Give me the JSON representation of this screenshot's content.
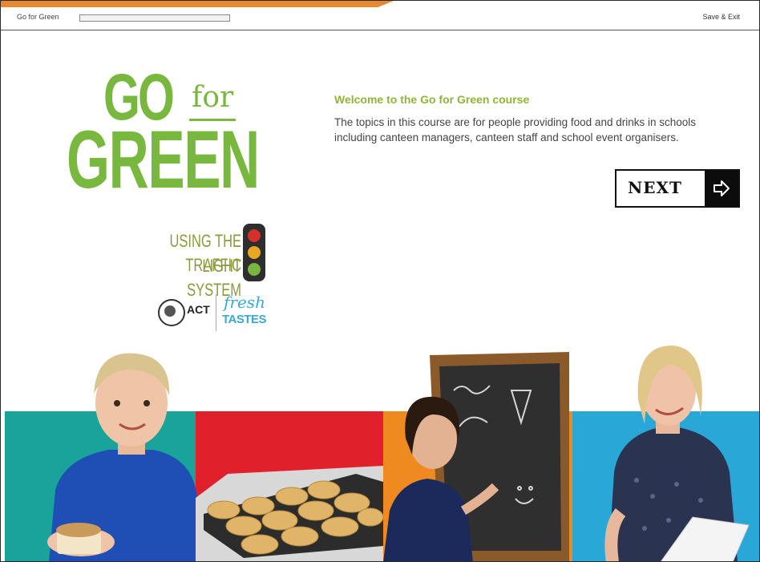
{
  "header": {
    "course_title": "Go for Green",
    "progress": 0.0,
    "save_exit_label": "Save & Exit"
  },
  "logo": {
    "go": "GO",
    "for": "for",
    "green": "GREEN",
    "traffic_text_1": "USING THE TRAFFIC",
    "traffic_text_2": "LIGHT SYSTEM",
    "act": "ACT",
    "fresh": "fresh",
    "tastes": "TASTES"
  },
  "main": {
    "welcome_title": "Welcome to the Go for Green course",
    "welcome_body": "The topics in this course are for people providing food and drinks in schools including canteen managers, canteen staff and school event organisers.",
    "next_label": "NEXT"
  },
  "colors": {
    "accent_green": "#78b83e",
    "teal": "#1aa39a",
    "red": "#e0202a",
    "orange": "#ef8a20",
    "blue": "#29a8d8"
  },
  "icons": {
    "next_arrow": "arrow-right-icon",
    "traffic_light": "traffic-light-icon"
  }
}
